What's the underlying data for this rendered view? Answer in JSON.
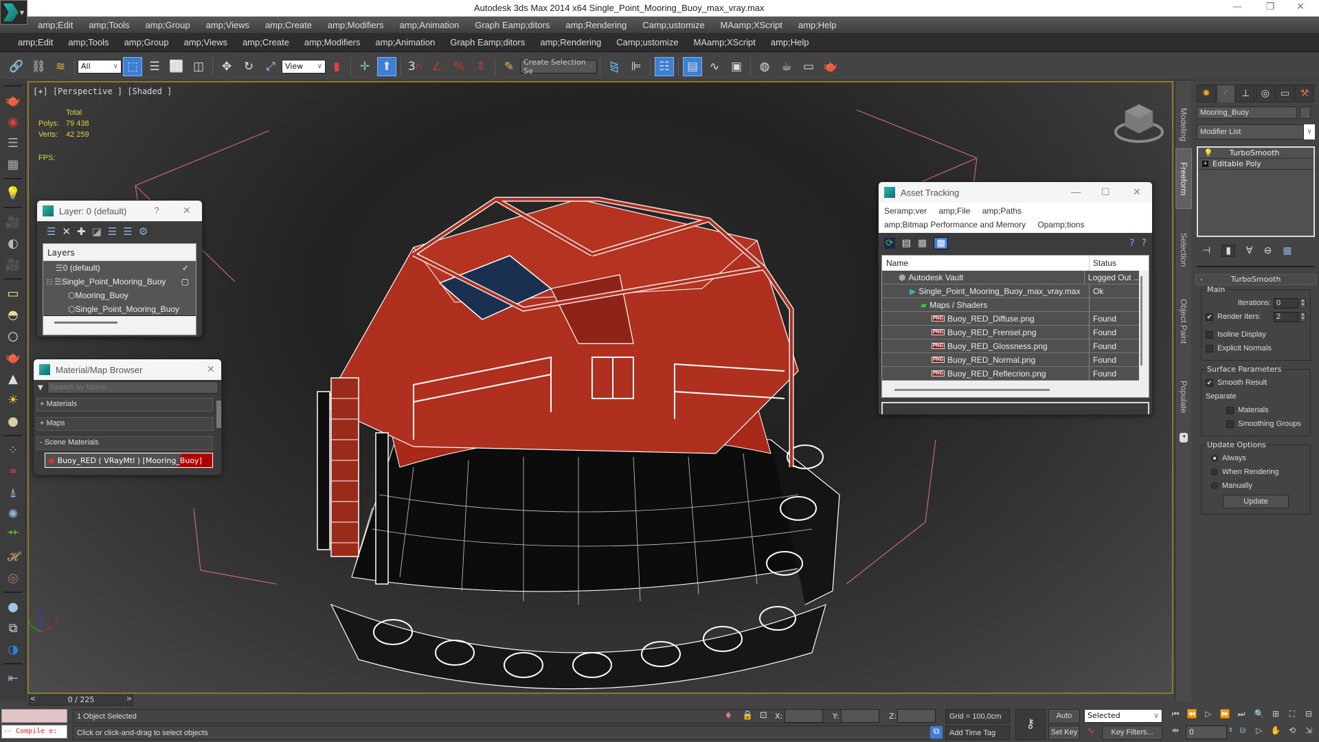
{
  "window": {
    "title": "Autodesk 3ds Max  2014 x64    Single_Point_Mooring_Buoy_max_vray.max",
    "controls": {
      "minimize": "—",
      "restore": "❐",
      "close": "✕"
    }
  },
  "menubar_primary": [
    "amp;Edit",
    "amp;Tools",
    "amp;Group",
    "amp;Views",
    "amp;Create",
    "amp;Modifiers",
    "amp;Animation",
    "Graph Eamp;ditors",
    "amp;Rendering",
    "Camp;ustomize",
    "MAamp;XScript",
    "amp;Help"
  ],
  "menubar_secondary": [
    "amp;Edit",
    "amp;Tools",
    "amp;Group",
    "amp;Views",
    "amp;Create",
    "amp;Modifiers",
    "amp;Animation",
    "Graph Eamp;ditors",
    "amp;Rendering",
    "Camp;ustomize",
    "MAamp;XScript",
    "amp;Help"
  ],
  "toolbar": {
    "selection_filter": "All",
    "reference_coord": "View",
    "named_selection_placeholder": "Create Selection Se",
    "snap_3d_label": "3"
  },
  "viewport": {
    "label": "[+] [Perspective ] [Shaded ]",
    "stats": {
      "total_label": "Total",
      "polys_label": "Polys:",
      "polys_value": "79 438",
      "verts_label": "Verts:",
      "verts_value": "42 259",
      "fps_label": "FPS:"
    },
    "axis": {
      "x": "x",
      "y": "y",
      "z": "z"
    }
  },
  "layer_dialog": {
    "title": "Layer: 0 (default)",
    "help": "?",
    "close": "✕",
    "column_header": "Layers",
    "rows": [
      {
        "name": "0 (default)",
        "indent": 1,
        "marker": "✓"
      },
      {
        "name": "Single_Point_Mooring_Buoy",
        "indent": 1,
        "marker": "▢",
        "expander": "⊟"
      },
      {
        "name": "Mooring_Buoy",
        "indent": 2,
        "marker": ""
      },
      {
        "name": "Single_Point_Mooring_Buoy",
        "indent": 2,
        "marker": ""
      }
    ]
  },
  "material_browser": {
    "title": "Material/Map Browser",
    "close": "✕",
    "search_placeholder": "Search by Name ...",
    "sections": [
      {
        "label": "+ Materials"
      },
      {
        "label": "+ Maps"
      },
      {
        "label": "- Scene Materials"
      }
    ],
    "scene_material": "Buoy_RED  ( VRayMtl )  [Mooring_Buoy]"
  },
  "asset_tracking": {
    "title": "Asset Tracking",
    "menu_row1": [
      "Seramp;ver",
      "amp;File",
      "amp;Paths"
    ],
    "menu_row2": [
      "amp;Bitmap Performance and Memory",
      "Opamp;tions"
    ],
    "columns": {
      "name": "Name",
      "status": "Status"
    },
    "rows": [
      {
        "name": "Autodesk Vault",
        "status": "Logged Out ...",
        "icon": "vault",
        "indent": 1
      },
      {
        "name": "Single_Point_Mooring_Buoy_max_vray.max",
        "status": "Ok",
        "icon": "max",
        "indent": 2
      },
      {
        "name": "Maps / Shaders",
        "status": "",
        "icon": "maps",
        "indent": 3
      },
      {
        "name": "Buoy_RED_Diffuse.png",
        "status": "Found",
        "icon": "png",
        "indent": 4
      },
      {
        "name": "Buoy_RED_Frensel.png",
        "status": "Found",
        "icon": "png",
        "indent": 4
      },
      {
        "name": "Buoy_RED_Glossness.png",
        "status": "Found",
        "icon": "png",
        "indent": 4
      },
      {
        "name": "Buoy_RED_Normal.png",
        "status": "Found",
        "icon": "png",
        "indent": 4
      },
      {
        "name": "Buoy_RED_Reflecrion.png",
        "status": "Found",
        "icon": "png",
        "indent": 4
      }
    ],
    "png_badge": "PNG"
  },
  "ribbon_tabs": [
    {
      "label": "Modeling",
      "active": false
    },
    {
      "label": "Freeform",
      "active": true
    },
    {
      "label": "Selection",
      "active": false
    },
    {
      "label": "Object Paint",
      "active": false
    },
    {
      "label": "Populate",
      "active": false
    }
  ],
  "command_panel": {
    "object_name": "Mooring_Buoy",
    "modifier_list": "Modifier List",
    "stack": [
      {
        "label": "TurboSmooth",
        "icon": "bulb"
      },
      {
        "label": "Editable Poly",
        "icon": "plus"
      }
    ],
    "rollout": {
      "title": "TurboSmooth",
      "collapse": "-",
      "main": {
        "title": "Main",
        "iterations_label": "Iterations:",
        "iterations_value": "0",
        "render_iters_label": "Render Iters:",
        "render_iters_value": "2",
        "render_iters_checked": true,
        "isoline_label": "Isoline Display",
        "isoline_checked": false,
        "explicit_normals_label": "Explicit Normals",
        "explicit_normals_checked": false
      },
      "surface": {
        "title": "Surface Parameters",
        "smooth_result_label": "Smooth Result",
        "smooth_result_checked": true,
        "separate_label": "Separate",
        "materials_label": "Materials",
        "smoothing_groups_label": "Smoothing Groups"
      },
      "update": {
        "title": "Update Options",
        "options": [
          "Always",
          "When Rendering",
          "Manually"
        ],
        "selected": "Always",
        "button": "Update"
      }
    }
  },
  "timeslider": {
    "prev": "<",
    "next": ">",
    "frame": "0 / 225"
  },
  "status": {
    "maxscript_output": "-- Compile e:",
    "selection_info": "1 Object Selected",
    "prompt": "Click or click-and-drag to select objects",
    "x_label": "X:",
    "y_label": "Y:",
    "z_label": "Z:",
    "grid": "Grid = 100,0cm",
    "add_time_tag": "Add Time Tag",
    "auto_key": "Auto Key",
    "set_key": "Set Key",
    "key_mode": "Selected",
    "key_filters": "Key Filters...",
    "current_frame": "0"
  },
  "colors": {
    "viewport_border": "#8c7a2a",
    "stats_text": "#e6d23c",
    "active_button": "#3e7fd6",
    "buoy_red": "#b0301f",
    "wire": "#ffffff",
    "bbox_pink": "#d06090"
  }
}
